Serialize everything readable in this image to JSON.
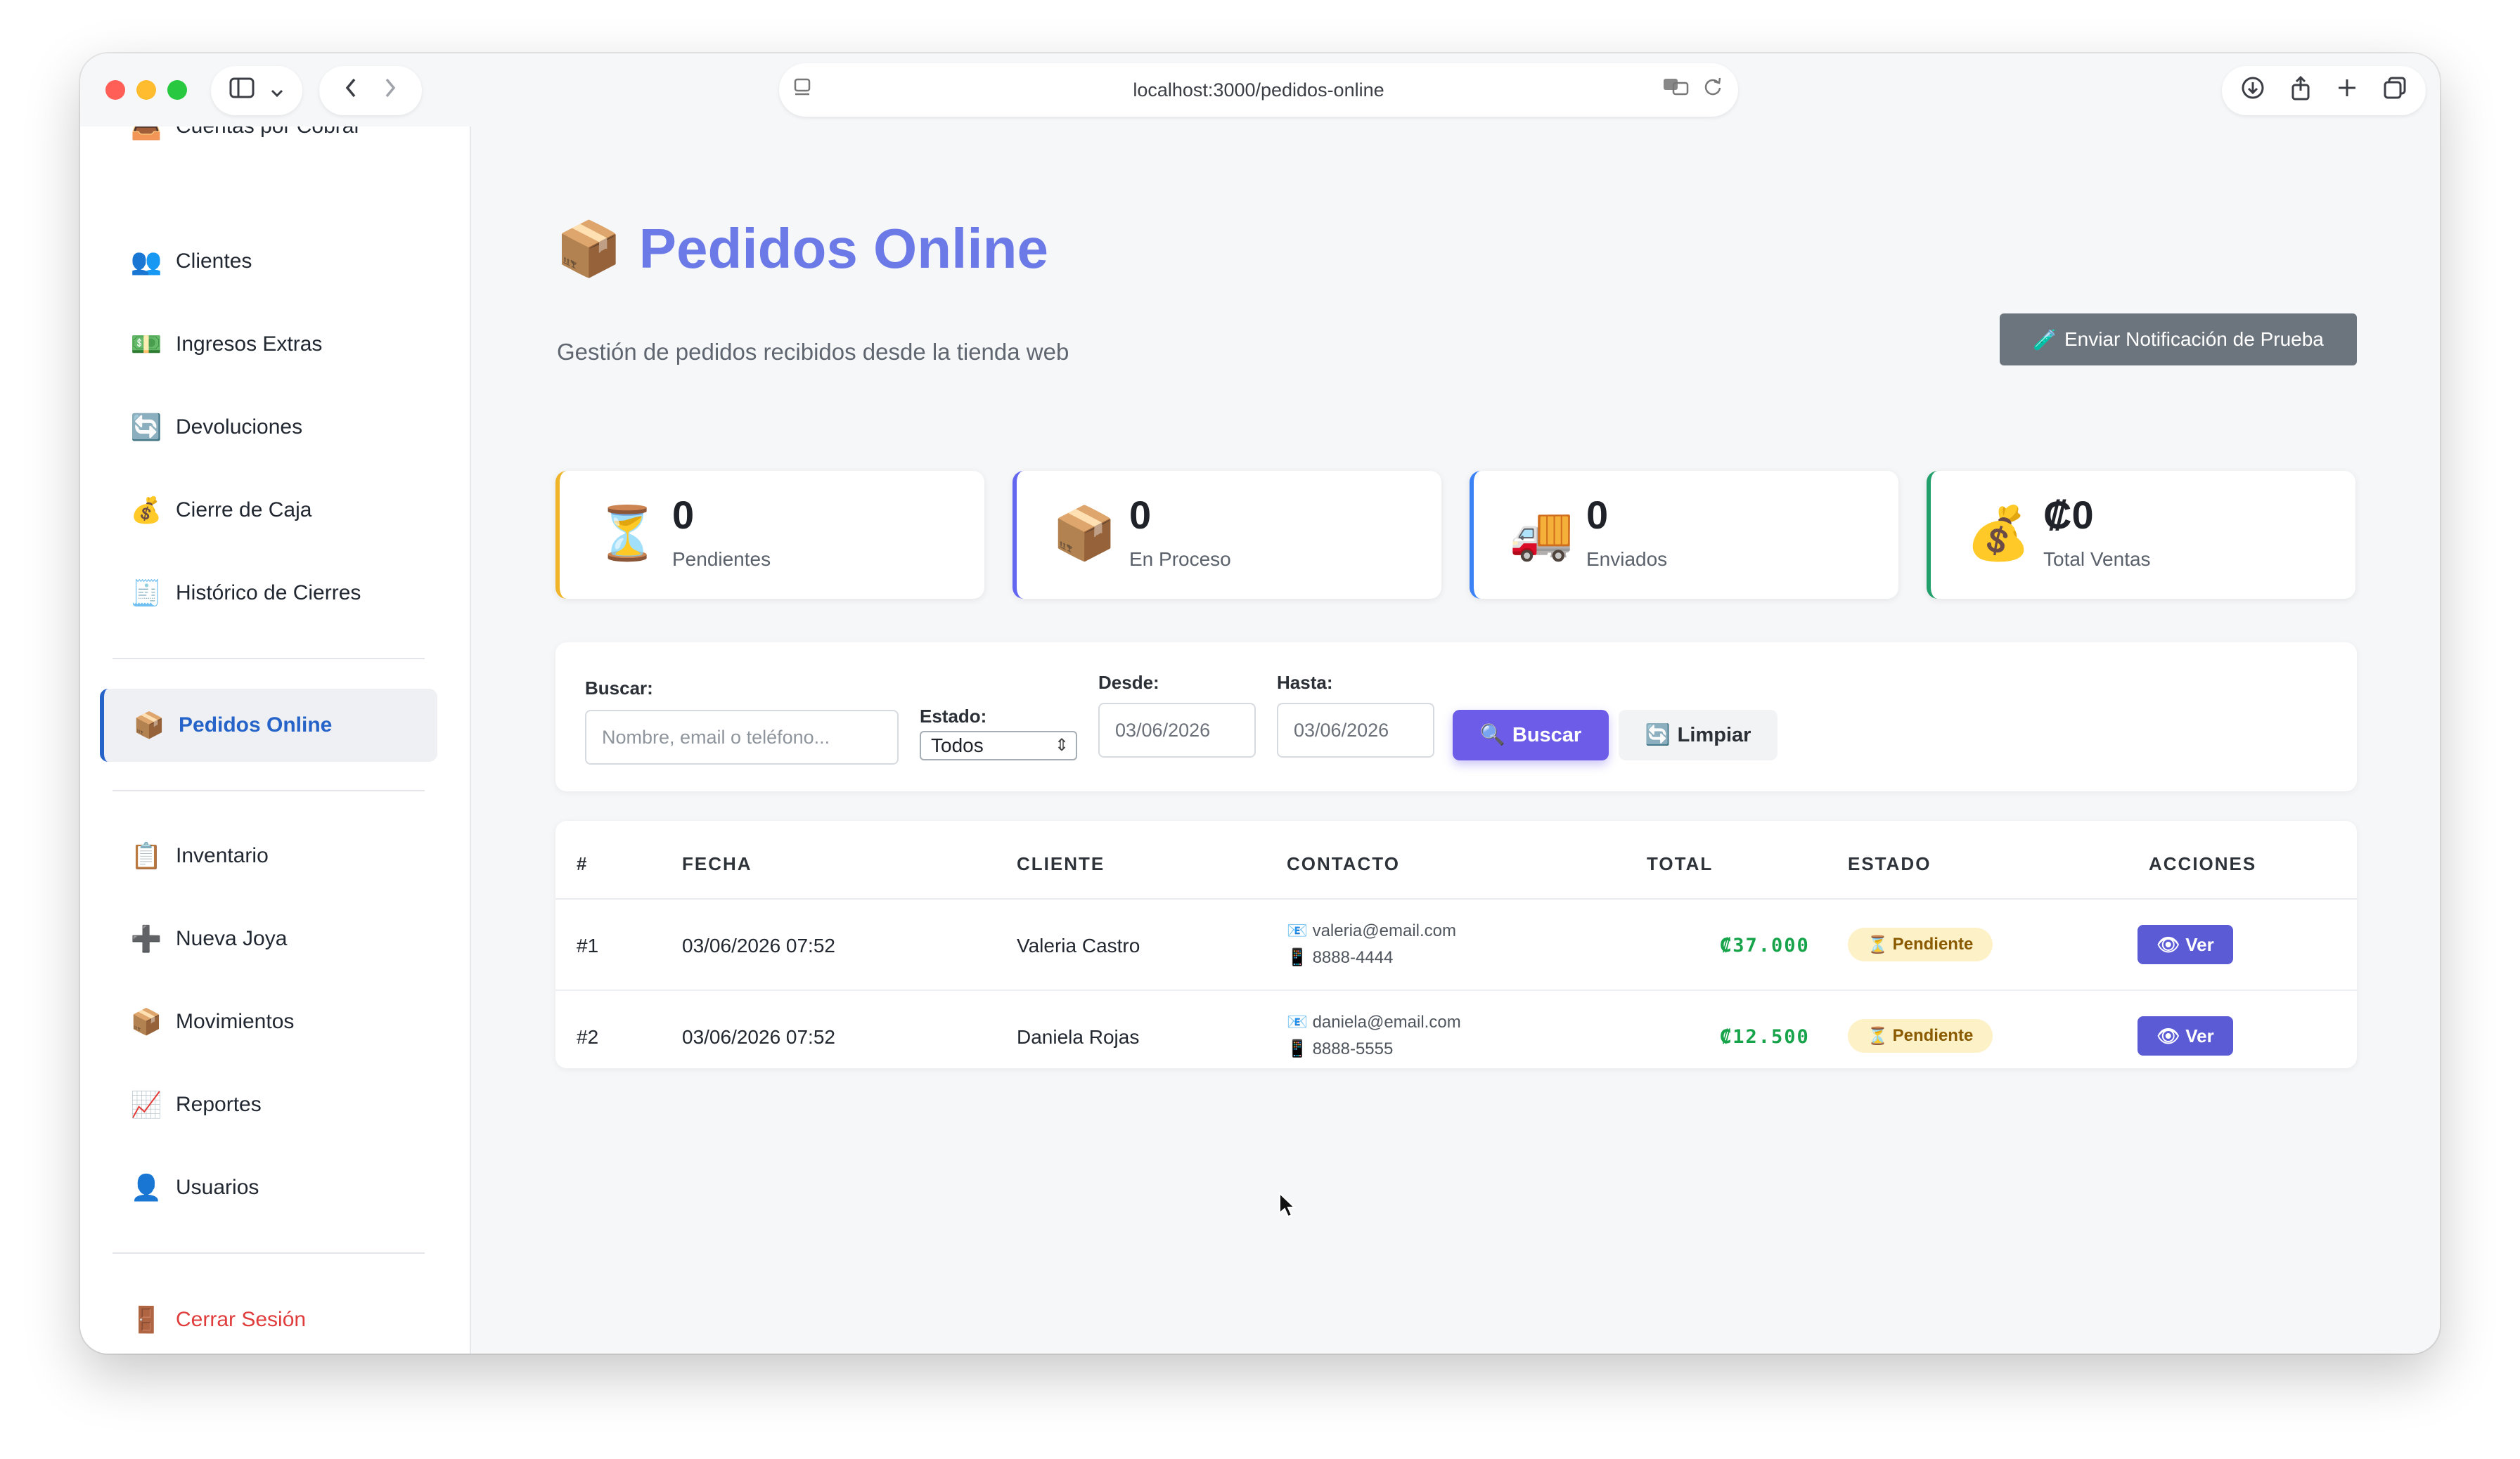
{
  "browser": {
    "url": "localhost:3000/pedidos-online",
    "sidebar_toggle_icon": "sidebar-icon",
    "back_icon": "‹",
    "forward_icon": "›"
  },
  "sidebar": {
    "items": [
      {
        "icon": "📥",
        "label": "Cuentas por Cobrar"
      },
      {
        "icon": "👥",
        "label": "Clientes"
      },
      {
        "icon": "💵",
        "label": "Ingresos Extras"
      },
      {
        "icon": "🔄",
        "label": "Devoluciones"
      },
      {
        "icon": "💰",
        "label": "Cierre de Caja"
      },
      {
        "icon": "🧾",
        "label": "Histórico de Cierres"
      },
      {
        "icon": "📦",
        "label": "Pedidos Online"
      },
      {
        "icon": "📋",
        "label": "Inventario"
      },
      {
        "icon": "➕",
        "label": "Nueva Joya"
      },
      {
        "icon": "📦",
        "label": "Movimientos"
      },
      {
        "icon": "📈",
        "label": "Reportes"
      },
      {
        "icon": "👤",
        "label": "Usuarios"
      },
      {
        "icon": "🚪",
        "label": "Cerrar Sesión"
      }
    ]
  },
  "header": {
    "title_icon": "📦",
    "title": "Pedidos Online",
    "subtitle": "Gestión de pedidos recibidos desde la tienda web",
    "notify_icon": "🧪",
    "notify_label": "Enviar Notificación de Prueba"
  },
  "stats": [
    {
      "icon": "⏳",
      "value": "0",
      "label": "Pendientes",
      "color": "#f0b429"
    },
    {
      "icon": "📦",
      "value": "0",
      "label": "En Proceso",
      "color": "#6366f1"
    },
    {
      "icon": "🚚",
      "value": "0",
      "label": "Enviados",
      "color": "#3b82f6"
    },
    {
      "icon": "💰",
      "value": "₡0",
      "label": "Total Ventas",
      "color": "#22a06b"
    }
  ],
  "filters": {
    "search_label": "Buscar:",
    "search_placeholder": "Nombre, email o teléfono...",
    "status_label": "Estado:",
    "status_value": "Todos",
    "from_label": "Desde:",
    "from_value": "03/06/2026",
    "to_label": "Hasta:",
    "to_value": "03/06/2026",
    "search_button": "Buscar",
    "search_button_icon": "🔍",
    "clear_button": "Limpiar",
    "clear_button_icon": "🔄"
  },
  "table": {
    "headers": [
      "#",
      "FECHA",
      "CLIENTE",
      "CONTACTO",
      "TOTAL",
      "ESTADO",
      "ACCIONES"
    ],
    "rows": [
      {
        "id": "#1",
        "date": "03/06/2026 07:52",
        "client": "Valeria Castro",
        "email": "valeria@email.com",
        "phone": "8888-4444",
        "total": "₡37.000",
        "status": "Pendiente",
        "action": "Ver"
      },
      {
        "id": "#2",
        "date": "03/06/2026 07:52",
        "client": "Daniela Rojas",
        "email": "daniela@email.com",
        "phone": "8888-5555",
        "total": "₡12.500",
        "status": "Pendiente",
        "action": "Ver"
      }
    ],
    "email_icon": "📧",
    "phone_icon": "📱",
    "status_icon": "⏳",
    "action_icon": "👁"
  }
}
